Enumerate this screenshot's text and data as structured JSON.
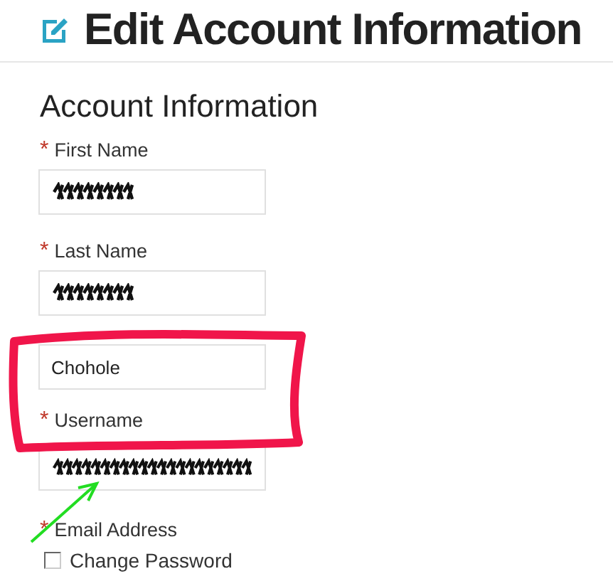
{
  "page_title": "Edit Account Information",
  "section_title": "Account Information",
  "required_mark": "*",
  "fields": [
    {
      "label": "First Name",
      "required": true,
      "kind": "redacted"
    },
    {
      "label": "Last Name",
      "required": true,
      "kind": "redacted"
    },
    {
      "kind": "text",
      "value": "Chohole"
    },
    {
      "label": "Username",
      "required": true,
      "kind": "redacted"
    },
    {
      "label": "Email Address",
      "required": true,
      "kind": "label"
    }
  ],
  "checkbox": {
    "label": "Change Password",
    "checked": false
  }
}
